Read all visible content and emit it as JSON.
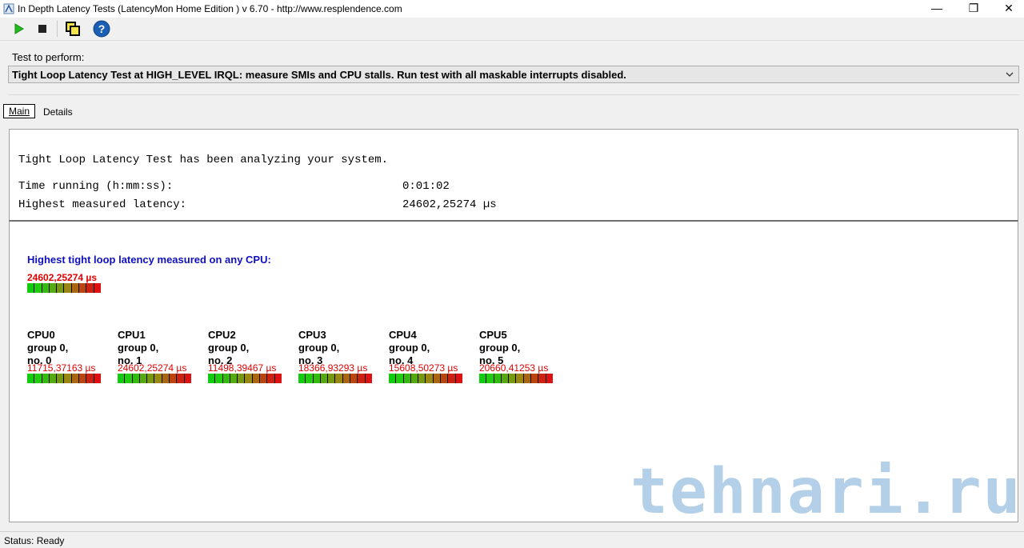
{
  "window": {
    "title": "In Depth Latency Tests  (LatencyMon Home Edition )  v 6.70 - http://www.resplendence.com",
    "controls": {
      "minimize": "—",
      "maximize": "❐",
      "close": "✕"
    }
  },
  "toolbar": {
    "icons": [
      "play-icon",
      "stop-icon",
      "copy-window-icon",
      "help-icon"
    ],
    "colors": {
      "play": "#22bb22",
      "help": "#1a5fb4"
    }
  },
  "test": {
    "label": "Test to perform:",
    "selected": "Tight Loop Latency Test at HIGH_LEVEL IRQL:  measure SMIs and CPU stalls. Run test with all maskable interrupts disabled."
  },
  "tabs": [
    {
      "label": "Main",
      "selected": true
    },
    {
      "label": "Details",
      "selected": false
    }
  ],
  "summary": {
    "heading": "Tight Loop Latency Test has been analyzing your system.",
    "rows": [
      {
        "label": "Time running (h:mm:ss):",
        "value": "0:01:02"
      },
      {
        "label": "Highest measured latency:",
        "value": "24602,25274 µs"
      }
    ]
  },
  "highest": {
    "title": "Highest tight loop latency measured on any CPU:",
    "value": "24602,25274 µs"
  },
  "cpus": [
    {
      "name": "CPU0",
      "group": "group 0,",
      "no": "no. 0",
      "value": "11715,37163 µs"
    },
    {
      "name": "CPU1",
      "group": "group 0,",
      "no": "no. 1",
      "value": "24602,25274 µs"
    },
    {
      "name": "CPU2",
      "group": "group 0,",
      "no": "no. 2",
      "value": "11498,39467 µs"
    },
    {
      "name": "CPU3",
      "group": "group 0,",
      "no": "no. 3",
      "value": "18366,93293 µs"
    },
    {
      "name": "CPU4",
      "group": "group 0,",
      "no": "no. 4",
      "value": "15608,50273 µs"
    },
    {
      "name": "CPU5",
      "group": "group 0,",
      "no": "no. 5",
      "value": "20660,41253 µs"
    }
  ],
  "meter_colors": [
    "#11cc11",
    "#22cc11",
    "#33bb11",
    "#55aa11",
    "#779911",
    "#998811",
    "#aa6611",
    "#bb4411",
    "#cc2211",
    "#dd1111"
  ],
  "value_color": "#e00000",
  "title_color": "#1010c0",
  "watermark": "tehnari.ru",
  "status": {
    "text": "Status: Ready"
  }
}
